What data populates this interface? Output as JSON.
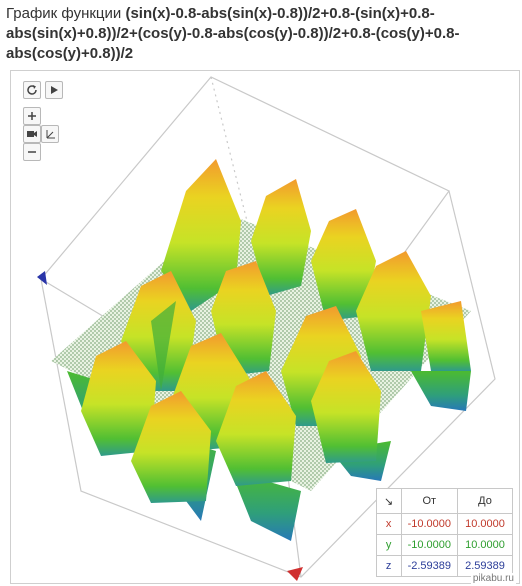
{
  "title": {
    "prefix": "График функции ",
    "function": "(sin(x)-0.8-abs(sin(x)-0.8))/2+0.8-(sin(x)+0.8-abs(sin(x)+0.8))/2+(cos(y)-0.8-abs(cos(y)-0.8))/2+0.8-(cos(y)+0.8-abs(cos(y)+0.8))/2"
  },
  "toolbar": {
    "reset_icon": "refresh-icon",
    "play_icon": "play-icon",
    "zoom_in_icon": "plus-icon",
    "camera_icon": "camera-icon",
    "axes_icon": "axes-icon",
    "zoom_out_icon": "minus-icon"
  },
  "ranges": {
    "corner_icon": "↘",
    "from_header": "От",
    "to_header": "До",
    "rows": [
      {
        "axis": "x",
        "from": "-10.0000",
        "to": "10.0000",
        "color": "#c0392b"
      },
      {
        "axis": "y",
        "from": "-10.0000",
        "to": "10.0000",
        "color": "#2e9e2e"
      },
      {
        "axis": "z",
        "from": "-2.59389",
        "to": "2.59389",
        "color": "#2c3e99"
      }
    ]
  },
  "surface": {
    "peak_color": "#f0a030",
    "mid_color": "#e8e020",
    "low_color": "#4cbb30",
    "base_color": "#2a8fb0"
  },
  "watermark": "pikabu.ru"
}
